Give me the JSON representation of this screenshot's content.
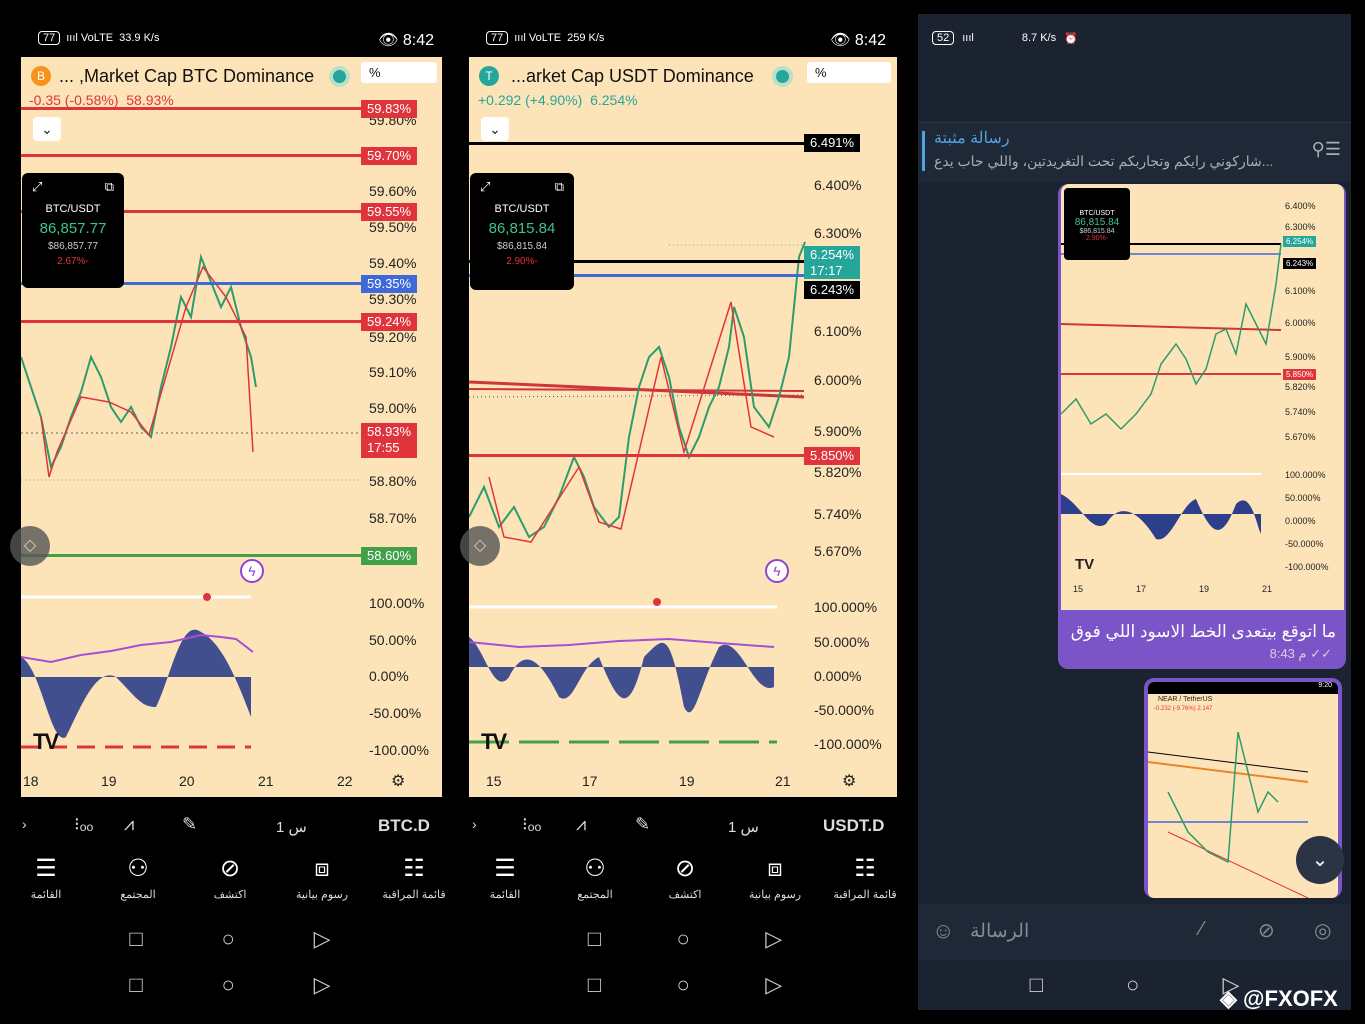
{
  "left_app": {
    "status": {
      "badge": "77",
      "signal": "ıııl VoLTE",
      "speed": "33.9 K/s",
      "time": "8:42"
    },
    "symbol_icon": "B",
    "title": "... ,Market Cap BTC Dominance",
    "change": "-0.35 (-0.58%)",
    "price": "58.93%",
    "scale_button": "%",
    "price_ticks": [
      "59.80%",
      "59.60%",
      "59.50%",
      "59.40%",
      "59.30%",
      "59.20%",
      "59.10%",
      "59.00%",
      "58.80%",
      "58.70%"
    ],
    "level_tags": [
      {
        "label": "59.83%",
        "color": "#e0343c"
      },
      {
        "label": "59.70%",
        "color": "#e0343c"
      },
      {
        "label": "59.55%",
        "color": "#e0343c"
      },
      {
        "label": "59.35%",
        "color": "#3f68d8"
      },
      {
        "label": "59.24%",
        "color": "#e0343c"
      },
      {
        "label": "58.93%",
        "color": "#e0343c"
      },
      {
        "label": "58.60%",
        "color": "#43a047"
      }
    ],
    "countdown": "17:55",
    "popup": {
      "symbol": "BTC/USDT",
      "price": "86,857.77",
      "price_small": "$86,857.77",
      "change": "2.67%-"
    },
    "osc_ticks": [
      "100.00%",
      "50.00%",
      "0.00%",
      "-50.00%",
      "-100.00%"
    ],
    "x_ticks": [
      "18",
      "19",
      "20",
      "21",
      "22"
    ],
    "toolbar_ticker": "BTC.D",
    "toolbar_interval": "1 س",
    "nav": [
      "القائمة",
      "المجتمع",
      "اكتشف",
      "رسوم بيانية",
      "قائمة المراقبة"
    ]
  },
  "mid_app": {
    "status": {
      "badge": "77",
      "signal": "ıııl VoLTE",
      "speed": "259 K/s",
      "time": "8:42"
    },
    "symbol_icon": "T",
    "title": "...arket Cap USDT Dominance",
    "change": "+0.292 (+4.90%)",
    "price": "6.254%",
    "scale_button": "%",
    "price_ticks": [
      "6.400%",
      "6.300%",
      "6.100%",
      "6.000%",
      "5.900%",
      "5.820%",
      "5.740%",
      "5.670%"
    ],
    "level_tags": [
      {
        "label": "6.491%",
        "color": "#000000"
      },
      {
        "label": "6.254%",
        "color": "#26a69a"
      },
      {
        "label": "6.243%",
        "color": "#000000"
      },
      {
        "label": "5.850%",
        "color": "#e0343c"
      }
    ],
    "countdown": "17:17",
    "popup": {
      "symbol": "BTC/USDT",
      "price": "86,815.84",
      "price_small": "$86,815.84",
      "change": "2.90%-"
    },
    "osc_ticks": [
      "100.000%",
      "50.000%",
      "0.000%",
      "-50.000%",
      "-100.000%"
    ],
    "x_ticks": [
      "15",
      "17",
      "19",
      "21"
    ],
    "toolbar_ticker": "USDT.D",
    "toolbar_interval": "1 س",
    "nav": [
      "القائمة",
      "المجتمع",
      "اكتشف",
      "رسوم بيانية",
      "قائمة المراقبة"
    ]
  },
  "telegram": {
    "status": {
      "badge": "52",
      "speed": "8.7 K/s"
    },
    "pinned_title": "رسالة مثبتة",
    "pinned_text": "شاركوني رايكم وتجاربكم تحت التغريدتين، واللي حاب يدع...",
    "image_ticks": [
      "6.400%",
      "6.300%",
      "6.254%",
      "6.243%",
      "6.100%",
      "6.000%",
      "5.900%",
      "5.850%",
      "5.820%",
      "5.740%",
      "5.670%",
      "100.000%",
      "50.000%",
      "0.000%",
      "-50.000%",
      "-100.000%"
    ],
    "image_x": [
      "15",
      "17",
      "19",
      "21"
    ],
    "image_popup": {
      "symbol": "BTC/USDT",
      "price": "86,815.84",
      "price_small": "$86,815.84",
      "change": "2.90%-"
    },
    "message": "ما اتوقع بيتعدى الخط الاسود اللي فوق",
    "message_time": "8:43 م",
    "preview_title": "NEAR / TetherUS",
    "preview_time": "9:20",
    "preview_change": "-0.232 (-9.76%) 2.147",
    "input_placeholder": "الرسالة"
  },
  "watermark": "@FXOFX"
}
